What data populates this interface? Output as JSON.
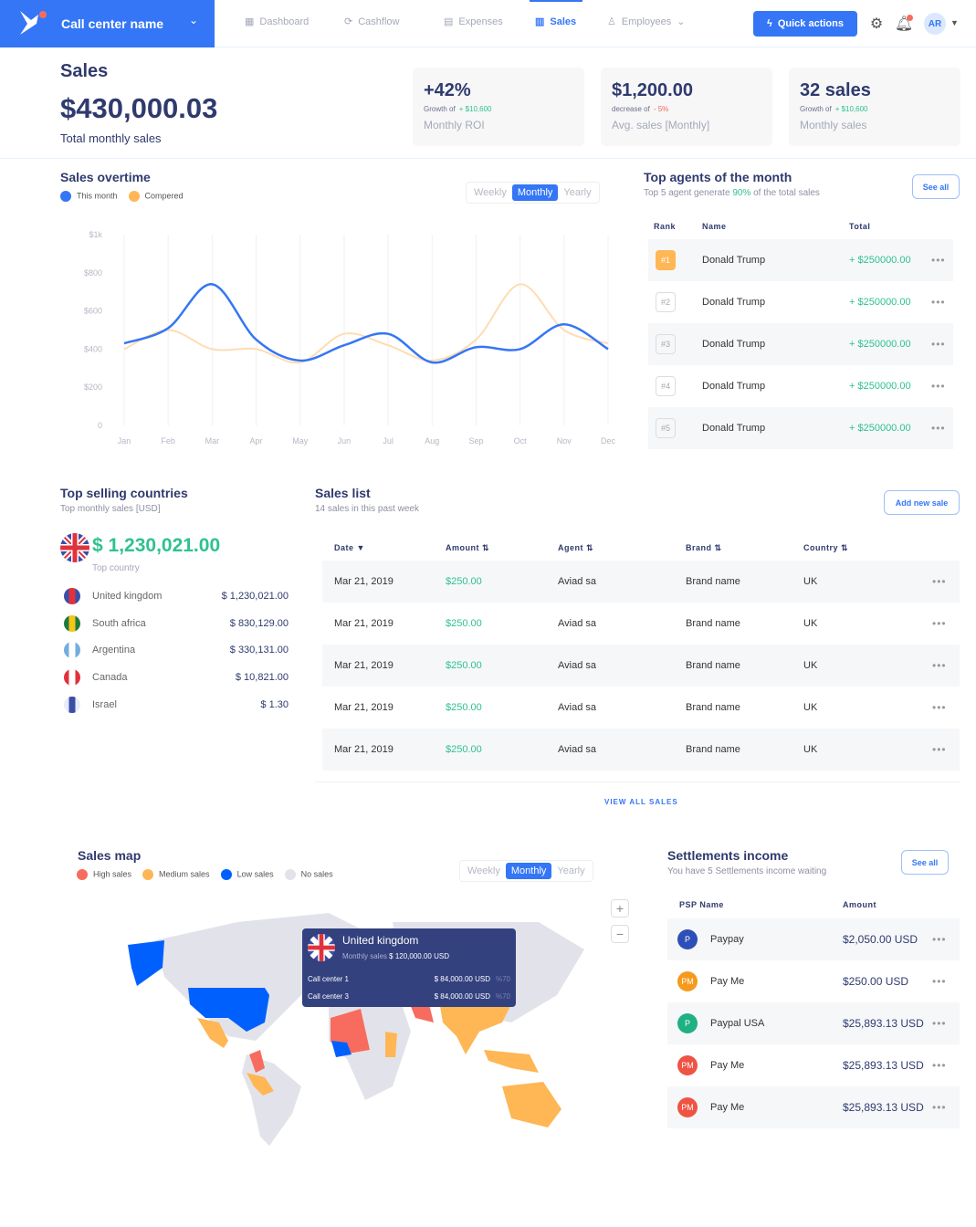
{
  "topbar": {
    "brand_name": "Call center name",
    "nav": [
      {
        "label": "Dashboard",
        "icon": "grid-icon"
      },
      {
        "label": "Cashflow",
        "icon": "cashflow-icon"
      },
      {
        "label": "Expenses",
        "icon": "receipt-icon"
      },
      {
        "label": "Sales",
        "icon": "bar-chart-icon",
        "active": true
      },
      {
        "label": "Employees",
        "icon": "user-icon"
      }
    ],
    "quick_actions": "Quick actions",
    "avatar_initials": "AR"
  },
  "header": {
    "title": "Sales",
    "total": "$430,000.03",
    "total_label": "Total monthly sales"
  },
  "kpis": [
    {
      "value": "+42%",
      "trend_label": "Growth of",
      "trend_value": "+ $10,600",
      "trend": "up",
      "label": "Monthly ROI"
    },
    {
      "value": "$1,200.00",
      "trend_label": "decrease of",
      "trend_value": "- 5%",
      "trend": "down",
      "label": "Avg. sales [Monthly]"
    },
    {
      "value": "32 sales",
      "trend_label": "Growth of",
      "trend_value": "+ $10,600",
      "trend": "up",
      "label": "Monthly sales"
    }
  ],
  "sales_overtime": {
    "title": "Sales overtime",
    "periods": [
      "Weekly",
      "Monthly",
      "Yearly"
    ],
    "active_period": "Monthly"
  },
  "chart_data": {
    "type": "line",
    "title": "Sales overtime",
    "xlabel": "",
    "ylabel": "",
    "x": [
      "Jan",
      "Feb",
      "Mar",
      "Apr",
      "May",
      "Jun",
      "Jul",
      "Aug",
      "Sep",
      "Oct",
      "Nov",
      "Dec"
    ],
    "ylim": [
      0,
      1000
    ],
    "yticks": [
      "0",
      "$200",
      "$400",
      "$600",
      "$800",
      "$1k"
    ],
    "grid": "vertical",
    "legend": "top-left",
    "series": [
      {
        "name": "This month",
        "color": "#3476f6",
        "values": [
          430,
          510,
          740,
          450,
          340,
          420,
          480,
          330,
          410,
          400,
          530,
          400
        ]
      },
      {
        "name": "Compered",
        "color": "#ffdcb4",
        "values": [
          400,
          500,
          400,
          400,
          330,
          480,
          420,
          340,
          450,
          740,
          500,
          430
        ]
      }
    ]
  },
  "top_agents": {
    "title": "Top agents of the month",
    "subtitle_pre": "Top 5 agent generate",
    "subtitle_pct": "90%",
    "subtitle_post": "of the total sales",
    "see_all": "See all",
    "columns": [
      "Rank",
      "Name",
      "Total"
    ],
    "rows": [
      {
        "rank": "#1",
        "name": "Donald Trump",
        "total": "+ $250000.00"
      },
      {
        "rank": "#2",
        "name": "Donald Trump",
        "total": "+ $250000.00"
      },
      {
        "rank": "#3",
        "name": "Donald Trump",
        "total": "+ $250000.00"
      },
      {
        "rank": "#4",
        "name": "Donald Trump",
        "total": "+ $250000.00"
      },
      {
        "rank": "#5",
        "name": "Donald Trump",
        "total": "+ $250000.00"
      }
    ]
  },
  "top_countries": {
    "title": "Top selling countries",
    "subtitle": "Top monthly sales [USD]",
    "top_value": "$ 1,230,021.00",
    "top_label": "Top country",
    "rows": [
      {
        "name": "United kingdom",
        "amount": "$ 1,230,021.00",
        "flag": "uk"
      },
      {
        "name": "South africa",
        "amount": "$ 830,129.00",
        "flag": "za"
      },
      {
        "name": "Argentina",
        "amount": "$ 330,131.00",
        "flag": "ar"
      },
      {
        "name": "Canada",
        "amount": "$ 10,821.00",
        "flag": "ca"
      },
      {
        "name": "Israel",
        "amount": "$ 1.30",
        "flag": "il"
      }
    ]
  },
  "sales_list": {
    "title": "Sales list",
    "subtitle": "14 sales in this past week",
    "add_button": "Add new sale",
    "columns": [
      "Date",
      "Amount",
      "Agent",
      "Brand",
      "Country"
    ],
    "rows": [
      {
        "date": "Mar 21, 2019",
        "amount": "$250.00",
        "agent": "Aviad sa",
        "brand": "Brand name",
        "country": "UK"
      },
      {
        "date": "Mar 21, 2019",
        "amount": "$250.00",
        "agent": "Aviad sa",
        "brand": "Brand name",
        "country": "UK"
      },
      {
        "date": "Mar 21, 2019",
        "amount": "$250.00",
        "agent": "Aviad sa",
        "brand": "Brand name",
        "country": "UK"
      },
      {
        "date": "Mar 21, 2019",
        "amount": "$250.00",
        "agent": "Aviad sa",
        "brand": "Brand name",
        "country": "UK"
      },
      {
        "date": "Mar 21, 2019",
        "amount": "$250.00",
        "agent": "Aviad sa",
        "brand": "Brand name",
        "country": "UK"
      }
    ],
    "view_all": "VIEW ALL SALES"
  },
  "sales_map": {
    "title": "Sales map",
    "legend": [
      {
        "label": "High sales",
        "color": "#f76c5e"
      },
      {
        "label": "Medium sales",
        "color": "#ffb655"
      },
      {
        "label": "Low sales",
        "color": "#0060fe"
      },
      {
        "label": "No sales",
        "color": "#e2e3ea"
      }
    ],
    "periods": [
      "Weekly",
      "Monthly",
      "Yearly"
    ],
    "active_period": "Monthly",
    "tooltip": {
      "country": "United kingdom",
      "monthly_label": "Monthly sales",
      "monthly_value": "$ 120,000.00 USD",
      "rows": [
        {
          "name": "Call center 1",
          "value": "$ 84,000.00 USD",
          "pct": "%70"
        },
        {
          "name": "Call center 3",
          "value": "$ 84,000.00 USD",
          "pct": "%70"
        }
      ]
    }
  },
  "settlements": {
    "title": "Settlements income",
    "subtitle": "You have 5 Settlements income waiting",
    "see_all": "See all",
    "columns": [
      "PSP Name",
      "Amount"
    ],
    "rows": [
      {
        "initials": "P",
        "name": "Paypay",
        "amount": "$2,050.00 USD",
        "color": "#2f4fb8"
      },
      {
        "initials": "PM",
        "name": "Pay Me",
        "amount": "$250.00 USD",
        "color": "#f59a1c"
      },
      {
        "initials": "P",
        "name": "Paypal USA",
        "amount": "$25,893.13 USD",
        "color": "#1fb084"
      },
      {
        "initials": "PM",
        "name": "Pay Me",
        "amount": "$25,893.13 USD",
        "color": "#ef5343"
      },
      {
        "initials": "PM",
        "name": "Pay Me",
        "amount": "$25,893.13 USD",
        "color": "#ef5343"
      }
    ]
  }
}
